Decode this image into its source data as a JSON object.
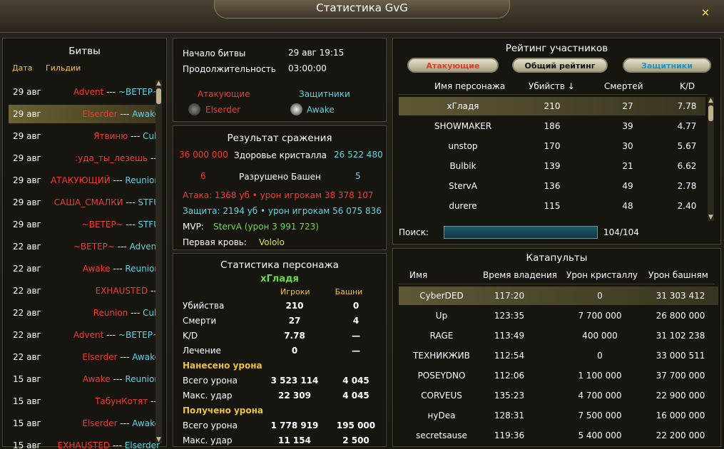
{
  "window": {
    "title": "Статистика GvG",
    "close_symbol": "✕"
  },
  "battles": {
    "title": "Битвы",
    "col_date": "Дата",
    "col_guilds": "Гильдии",
    "rows": [
      {
        "date": "29 авг",
        "attacker": "Advent",
        "sep": " --- ",
        "defender": "~ВЕТЕР~"
      },
      {
        "date": "29 авг",
        "attacker": "Elserder",
        "sep": " --- ",
        "defender": "Awake"
      },
      {
        "date": "29 авг",
        "attacker": "Ятвиню",
        "sep": " --- ",
        "defender": "Cult"
      },
      {
        "date": "29 авг",
        "attacker": ":уда_ты_лезешь",
        "sep": " --- ",
        "defender": ""
      },
      {
        "date": "29 авг",
        "attacker": "АТАКУЮЩИЙ",
        "sep": " --- ",
        "defender": "Reunion"
      },
      {
        "date": "29 авг",
        "attacker": "САША_СМАЛКИ",
        "sep": " --- ",
        "defender": "STFU"
      },
      {
        "date": "29 авг",
        "attacker": "~ВЕТЕР~",
        "sep": " --- ",
        "defender": "STFU"
      },
      {
        "date": "22 авг",
        "attacker": "~ВЕТЕР~",
        "sep": " --- ",
        "defender": "Advent"
      },
      {
        "date": "22 авг",
        "attacker": "Awake",
        "sep": " --- ",
        "defender": "Reunion"
      },
      {
        "date": "22 авг",
        "attacker": "EXHAUSTED",
        "sep": " --- ",
        "defender": ""
      },
      {
        "date": "22 авг",
        "attacker": "Reunion",
        "sep": " --- ",
        "defender": "Cult"
      },
      {
        "date": "22 авг",
        "attacker": "Advent",
        "sep": " --- ",
        "defender": "~ВЕТЕР~"
      },
      {
        "date": "22 авг",
        "attacker": "Elserder",
        "sep": " --- ",
        "defender": "Awake"
      },
      {
        "date": "15 авг",
        "attacker": "Awake",
        "sep": " --- ",
        "defender": "Reunion"
      },
      {
        "date": "15 авг",
        "attacker": "ТабунКотят",
        "sep": " --- ",
        "defender": ""
      },
      {
        "date": "15 авг",
        "attacker": "Elserder",
        "sep": " --- ",
        "defender": "Awake"
      },
      {
        "date": "15 авг",
        "attacker": "EXHAUSTED",
        "sep": " --- ",
        "defender": "Elserder"
      }
    ]
  },
  "info": {
    "start_label": "Начало битвы",
    "start_value": "29 авг 19:15",
    "duration_label": "Продолжительность",
    "duration_value": "03:00:00",
    "attackers_label": "Атакующие",
    "defenders_label": "Защитники",
    "attacker_guild": "Elserder",
    "defender_guild": "Awake"
  },
  "result": {
    "title": "Результат сражения",
    "crystal_left": "36 000 000",
    "crystal_label": "Здоровье кристалла",
    "crystal_right": "26 522 480",
    "towers_left": "6",
    "towers_label": "Разрушено Башен",
    "towers_right": "5",
    "attack_line": "Атака:   1368 уб   •   урон игрокам 38 378 107",
    "defense_line": "Защита: 2194 уб   •   урон игрокам 56 075 836",
    "mvp_label": "MVP:",
    "mvp_value": "StervA (урон 3 991 723)",
    "first_blood_label": "Первая кровь:",
    "first_blood_value": "Vololo"
  },
  "char_stats": {
    "title": "Статистика персонажа",
    "name": "хГладя",
    "col_players": "Игроки",
    "col_towers": "Башни",
    "rows": [
      {
        "label": "Убийства",
        "players": "210",
        "towers": "0"
      },
      {
        "label": "Смерти",
        "players": "27",
        "towers": "4"
      },
      {
        "label": "K/D",
        "players": "7.78",
        "towers": "—"
      },
      {
        "label": "Лечение",
        "players": "0",
        "towers": "—"
      }
    ],
    "dealt_header": "Нанесено урона",
    "dealt": [
      {
        "label": "Всего урона",
        "players": "3 523 114",
        "towers": "4 045"
      },
      {
        "label": "Макс. удар",
        "players": "22 309",
        "towers": "4 045"
      }
    ],
    "taken_header": "Получено урона",
    "taken": [
      {
        "label": "Всего урона",
        "players": "1 778 919",
        "towers": "195 000"
      },
      {
        "label": "Макс. удар",
        "players": "11 154",
        "towers": "2 500"
      }
    ]
  },
  "rating": {
    "title": "Рейтинг участников",
    "tabs": [
      "Атакующие",
      "Общий рейтинг",
      "Защитники"
    ],
    "col_name": "Имя персонажа",
    "col_kills": "Убийств ↓",
    "col_deaths": "Смертей",
    "col_kd": "K/D",
    "rows": [
      {
        "name": "хГладя",
        "kills": "210",
        "deaths": "27",
        "kd": "7.78"
      },
      {
        "name": "SHOWMAKER",
        "kills": "186",
        "deaths": "39",
        "kd": "4.77"
      },
      {
        "name": "unstop",
        "kills": "170",
        "deaths": "30",
        "kd": "5.67"
      },
      {
        "name": "Bulbik",
        "kills": "139",
        "deaths": "21",
        "kd": "6.62"
      },
      {
        "name": "StervA",
        "kills": "136",
        "deaths": "49",
        "kd": "2.78"
      },
      {
        "name": "durere",
        "kills": "115",
        "deaths": "48",
        "kd": "2.40"
      }
    ],
    "search_label": "Поиск:",
    "search_value": "",
    "count": "104/104"
  },
  "catapults": {
    "title": "Катапульты",
    "col_name": "Имя",
    "col_time": "Время владения",
    "col_crystal": "Урон кристаллу",
    "col_towers": "Урон башням",
    "rows": [
      {
        "name": "CyberDED",
        "time": "117:20",
        "crystal": "0",
        "towers": "31 303 412"
      },
      {
        "name": "Up",
        "time": "123:35",
        "crystal": "7 700 000",
        "towers": "26 800 000"
      },
      {
        "name": "RAGE",
        "time": "113:49",
        "crystal": "400 000",
        "towers": "31 102 238"
      },
      {
        "name": "ТЕХНИКЖИВ",
        "time": "112:54",
        "crystal": "0",
        "towers": "33 000 511"
      },
      {
        "name": "POSEYDNO",
        "time": "112:06",
        "crystal": "1 100 000",
        "towers": "37 700 000"
      },
      {
        "name": "CORVEUS",
        "time": "135:23",
        "crystal": "4 700 000",
        "towers": "22 900 000"
      },
      {
        "name": "нуDea",
        "time": "128:31",
        "crystal": "7 500 000",
        "towers": "16 000 000"
      },
      {
        "name": "secretsause",
        "time": "119:36",
        "crystal": "5 400 000",
        "towers": "22 200 000"
      }
    ]
  }
}
